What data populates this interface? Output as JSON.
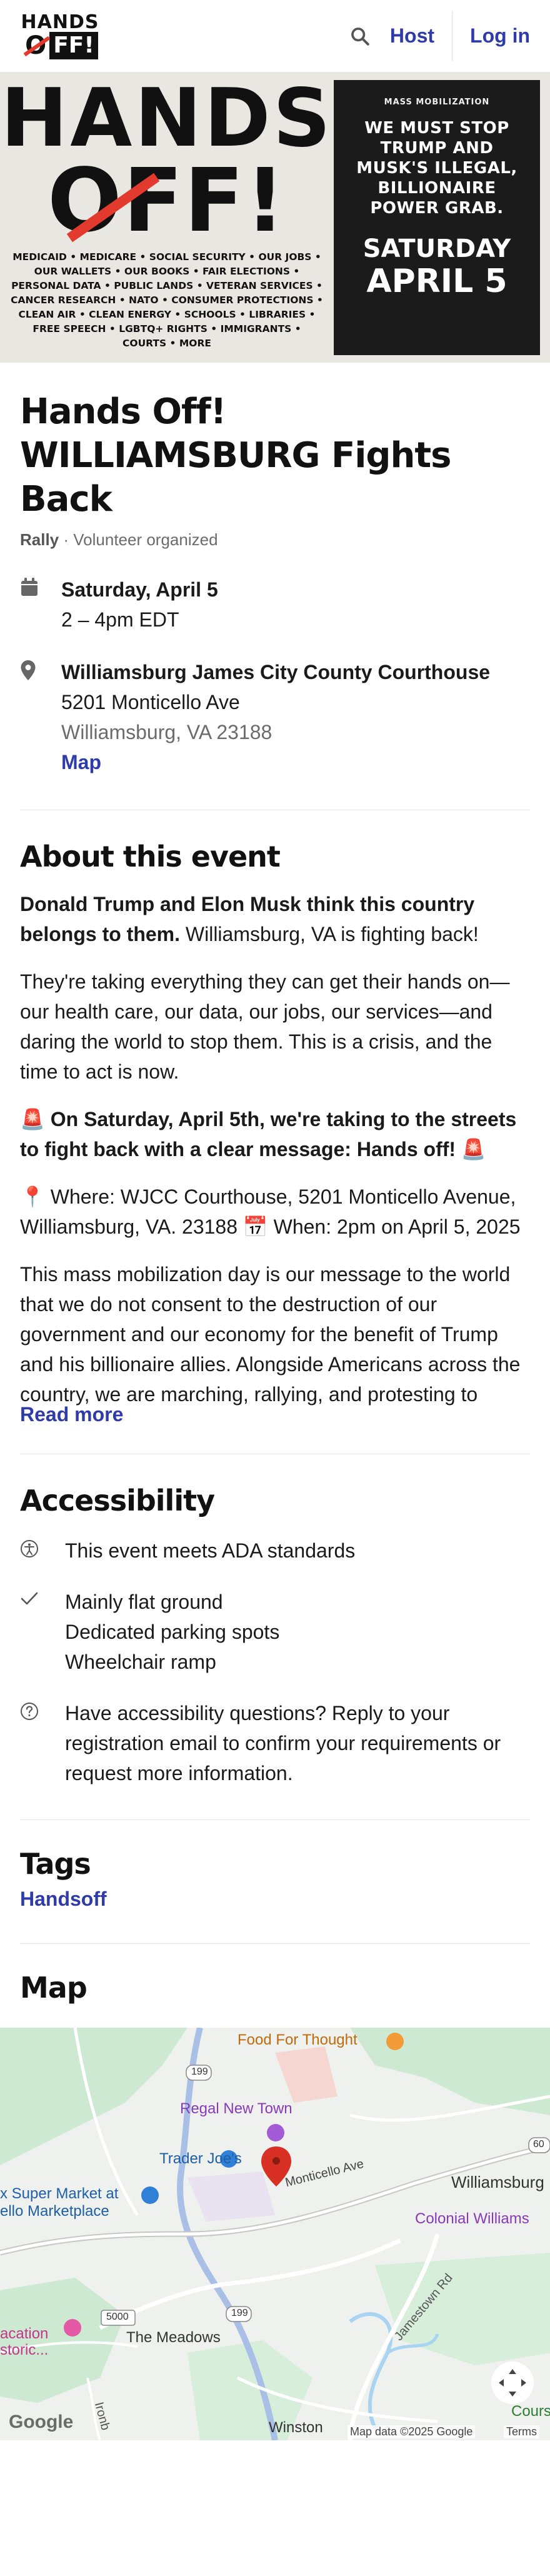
{
  "header": {
    "logo_top": "HANDS",
    "logo_o": "O",
    "logo_ff": "FF!",
    "host_label": "Host",
    "login_label": "Log in"
  },
  "banner": {
    "hands": "HANDS",
    "off": "OFF!",
    "issues": "MEDICAID • MEDICARE • SOCIAL SECURITY • OUR JOBS • OUR WALLETS • OUR BOOKS • FAIR ELECTIONS • PERSONAL DATA • PUBLIC LANDS • VETERAN SERVICES • CANCER RESEARCH • NATO • CONSUMER PROTECTIONS • CLEAN AIR • CLEAN ENERGY • SCHOOLS • LIBRARIES • FREE SPEECH • LGBTQ+ RIGHTS • IMMIGRANTS • COURTS • MORE",
    "kicker": "MASS MOBILIZATION",
    "message": "WE MUST STOP TRUMP AND MUSK'S ILLEGAL, BILLIONAIRE POWER GRAB.",
    "date_line1": "SATURDAY",
    "date_line2": "APRIL 5"
  },
  "event": {
    "title": "Hands Off! WILLIAMSBURG Fights Back",
    "type": "Rally",
    "organizer": " · Volunteer organized",
    "date": "Saturday, April 5",
    "time": "2 – 4pm EDT",
    "venue": "Williamsburg James City County Courthouse",
    "street": "5201 Monticello Ave",
    "city": "Williamsburg, VA 23188",
    "map_link": "Map"
  },
  "about": {
    "title": "About this event",
    "p1_bold": "Donald Trump and Elon Musk think this country belongs to them.",
    "p1_rest": " Williamsburg, VA is fighting back!",
    "p2": "They're taking everything they can get their hands on—our health care, our data, our jobs, our services—and daring the world to stop them. This is a crisis, and the time to act is now.",
    "p3_emoji_left": "🚨",
    "p3_bold": " On Saturday, April 5th, we're taking to the streets to fight back with a clear message: Hands off! ",
    "p3_emoji_right": "🚨",
    "p4": "📍 Where: WJCC Courthouse, 5201 Monticello Avenue, Williamsburg, VA. 23188 📅 When: 2pm on April 5, 2025",
    "p5": "This mass mobilization day is our message to the world that we do not consent to the destruction of our government and our economy for the benefit of Trump and his billionaire allies. Alongside Americans across the country, we are marching, rallying, and protesting to",
    "read_more": "Read more"
  },
  "accessibility": {
    "title": "Accessibility",
    "ada": "This event meets ADA standards",
    "features": [
      "Mainly flat ground",
      "Dedicated parking spots",
      "Wheelchair ramp"
    ],
    "question": "Have accessibility questions? Reply to your registration email to confirm your requirements or request more information."
  },
  "tags": {
    "title": "Tags",
    "items": [
      "Handsoff"
    ]
  },
  "map_section": {
    "title": "Map",
    "labels": {
      "food_for_thought": "Food For Thought",
      "regal": "Regal New Town",
      "trader_joes": "Trader Joe's",
      "monticello_ave": "Monticello Ave",
      "williamsburg": "Williamsburg",
      "colonial": "Colonial Williams",
      "super_market": "x Super Market at",
      "marketplace": "ello Marketplace",
      "the_meadows": "The Meadows",
      "vacation": "acation",
      "storic": "storic...",
      "jamestown_rd": "Jamestown Rd",
      "course": "Course at",
      "winston": "Winston",
      "ironb": "Ironb",
      "r199a": "199",
      "r199b": "199",
      "r5000": "5000",
      "r60": "60",
      "google": "Google",
      "map_data": "Map data ©2025 Google",
      "terms": "Terms"
    }
  },
  "colors": {
    "link": "#2f3ba8",
    "accent_red": "#e23b2e",
    "map_pin": "#d93025"
  }
}
